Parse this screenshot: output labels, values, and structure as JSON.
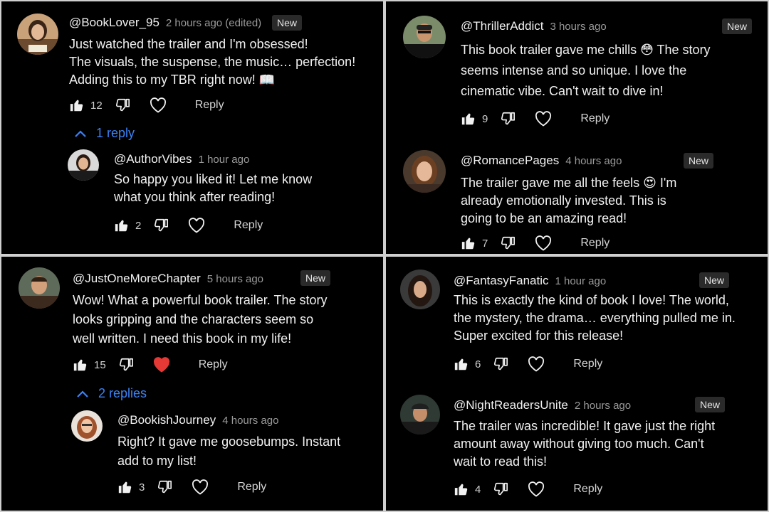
{
  "colors": {
    "background": "#000000",
    "accent_blue": "#3b82f6",
    "heart_red": "#e53935",
    "badge_bg": "#2a2a2a",
    "divider": "#cfcfcf"
  },
  "icons": {
    "like": "thumbs-up-icon",
    "dislike": "thumbs-down-icon",
    "heart": "heart-icon",
    "toggle": "chevron-up-icon"
  },
  "reply_label": "Reply",
  "panel1": {
    "c1": {
      "username": "@BookLover_95",
      "time": "2 hours ago (edited)",
      "badge": "New",
      "lines": [
        "Just watched the trailer and I'm obsessed!",
        "The visuals, the suspense, the music… perfection!",
        "Adding this to my TBR right now! 📖"
      ],
      "likes": "12",
      "liked": true,
      "hearted": false
    },
    "toggle": "1 reply",
    "r1": {
      "username": "@AuthorVibes",
      "time": "1 hour ago",
      "lines": [
        "So happy you liked it! Let me know",
        "what you think after reading!"
      ],
      "likes": "2",
      "liked": true,
      "hearted": false
    }
  },
  "panel2": {
    "c1": {
      "username": "@ThrillerAddict",
      "time": "3 hours ago",
      "badge": "New",
      "lines": [
        "This book trailer gave me chills 😳 The story",
        "seems intense and so unique. I love the",
        "cinematic vibe. Can't wait to dive in!"
      ],
      "likes": "9",
      "liked": true,
      "hearted": false
    },
    "c2": {
      "username": "@RomancePages",
      "time": "4 hours ago",
      "badge": "New",
      "lines": [
        "The trailer gave me all the feels 😍 I'm",
        "already emotionally invested. This is",
        "going to be an amazing read!"
      ],
      "likes": "7",
      "liked": true,
      "hearted": false
    }
  },
  "panel3": {
    "c1": {
      "username": "@JustOneMoreChapter",
      "time": "5 hours ago",
      "badge": "New",
      "lines": [
        "Wow! What a powerful book trailer. The story",
        "looks gripping and the characters seem so",
        "well written. I need this book in my life!"
      ],
      "likes": "15",
      "liked": true,
      "hearted": true
    },
    "toggle": "2 replies",
    "r1": {
      "username": "@BookishJourney",
      "time": "4 hours ago",
      "lines": [
        "Right? It gave me goosebumps. Instant",
        "add to my list!"
      ],
      "likes": "3",
      "liked": true,
      "hearted": false
    }
  },
  "panel4": {
    "c1": {
      "username": "@FantasyFanatic",
      "time": "1 hour ago",
      "badge": "New",
      "lines": [
        "This is exactly the kind of book I love! The world,",
        "the mystery, the drama… everything pulled me in.",
        "Super excited for this release!"
      ],
      "likes": "6",
      "liked": true,
      "hearted": false
    },
    "c2": {
      "username": "@NightReadersUnite",
      "time": "2 hours ago",
      "badge": "New",
      "lines": [
        "The trailer was incredible! It gave just the right",
        "amount away without giving too much. Can't",
        "wait to read this!"
      ],
      "likes": "4",
      "liked": true,
      "hearted": false
    }
  }
}
